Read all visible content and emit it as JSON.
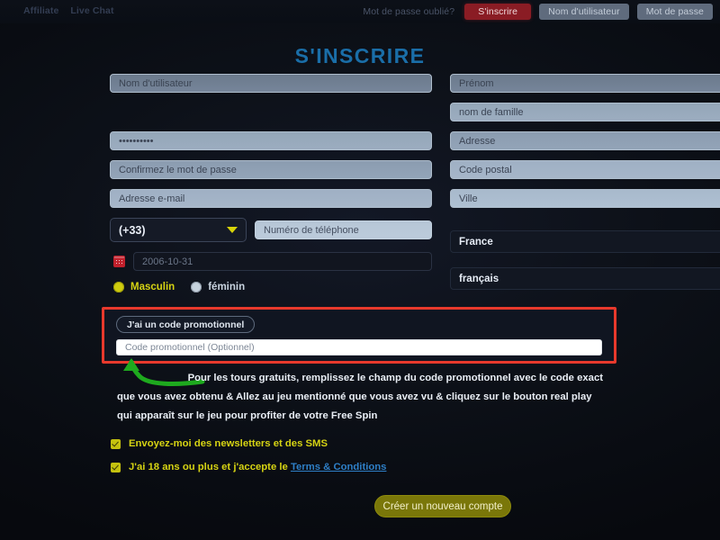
{
  "header": {
    "left_links": [
      {
        "label": "Affiliate",
        "name": "affiliate-link"
      },
      {
        "label": "Live Chat",
        "name": "live-chat-link"
      }
    ],
    "forgot_password": "Mot de passe oublié?",
    "signup_button": "S'inscrire",
    "username_button": "Nom d'utilisateur",
    "password_button": "Mot de passe"
  },
  "page_title": "S'INSCRIRE",
  "form": {
    "left": {
      "username_placeholder": "Nom d'utilisateur",
      "password_value": "••••••••••",
      "confirm_password_placeholder": "Confirmez le mot de passe",
      "email_placeholder": "Adresse e-mail",
      "country_code_value": "(+33)",
      "phone_placeholder": "Numéro de téléphone",
      "birthdate_value": "2006-10-31"
    },
    "right": {
      "firstname_placeholder": "Prénom",
      "lastname_placeholder": "nom de famille",
      "address_placeholder": "Adresse",
      "postcode_placeholder": "Code postal",
      "city_placeholder": "Ville",
      "country_value": "France",
      "language_value": "français"
    },
    "gender": {
      "male_label": "Masculin",
      "female_label": "féminin",
      "selected": "Masculin"
    }
  },
  "promo": {
    "pill_label": "J'ai un code promotionnel",
    "input_placeholder": "Code promotionnel (Optionnel)",
    "highlight_color": "#e8392c"
  },
  "instructions": {
    "line1": "Pour les tours gratuits, remplissez le champ du code promotionnel avec le code exact",
    "line2": "que vous avez obtenu & Allez au jeu mentionné que vous avez vu & cliquez sur le bouton real play",
    "line3": "qui apparaît sur le jeu pour profiter de votre Free Spin",
    "arrow_color": "#1eaa1e"
  },
  "checkboxes": [
    {
      "label": "Envoyez-moi des newsletters et des SMS",
      "checked": true
    },
    {
      "label": "J'ai 18 ans ou plus et j'accepte le ",
      "checked": true,
      "link": "Terms & Conditions"
    }
  ],
  "submit": {
    "label": "Créer un nouveau compte"
  },
  "colors": {
    "accent_yellow": "#d6d313",
    "title_blue": "#1a6ea8",
    "link_blue": "#2e7fc7",
    "signup_red": "#8a1c24",
    "highlight_red": "#e8392c",
    "arrow_green": "#1eaa1e"
  }
}
